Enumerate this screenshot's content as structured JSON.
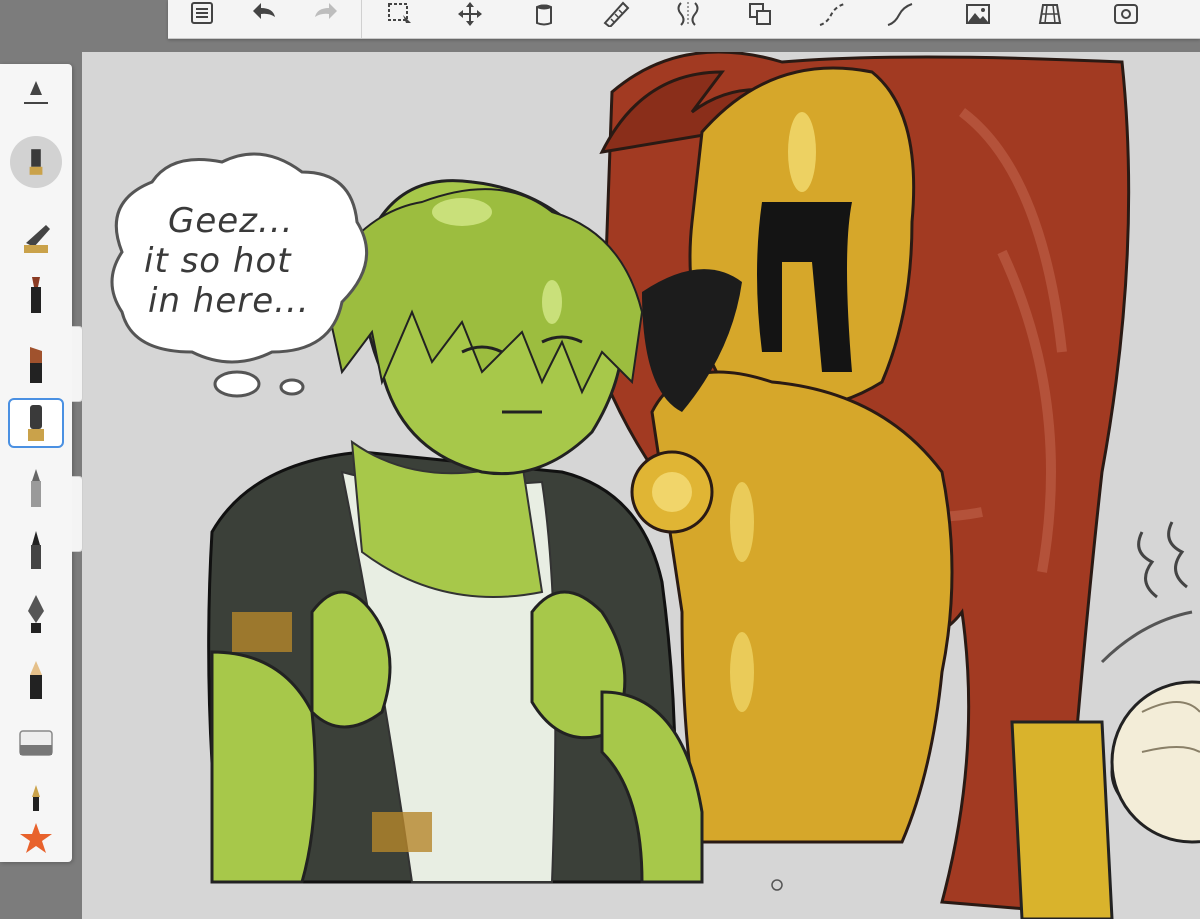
{
  "toolbar": {
    "icons": [
      "list-icon",
      "undo-icon",
      "redo-icon",
      "selection-icon",
      "transform-icon",
      "fill-icon",
      "ruler-icon",
      "symmetry-icon",
      "layers-copy-icon",
      "curve-icon",
      "stroke-icon",
      "image-icon",
      "perspective-icon",
      "canvas-icon"
    ]
  },
  "brushes": {
    "selected": "brush-round",
    "items": [
      "brush-opacity-slider",
      "brush-puck",
      "brush-airbrush",
      "brush-marker",
      "brush-flat",
      "brush-round",
      "brush-pen",
      "brush-ink",
      "brush-nib",
      "brush-pencil",
      "brush-eraser",
      "brush-pen-small",
      "brush-favorite"
    ]
  },
  "canvas": {
    "speech_line1": "Geez...",
    "speech_line2": "it so hot",
    "speech_line3": "in here...",
    "colors": {
      "background": "#d6d6d6",
      "slime": "#a7c84a",
      "slime_dark": "#8caa37",
      "armor": "#d6a72a",
      "cape": "#a23a22",
      "jacket": "#3b4039",
      "shirt": "#e8eee3",
      "fan": "#d9b32c"
    }
  }
}
